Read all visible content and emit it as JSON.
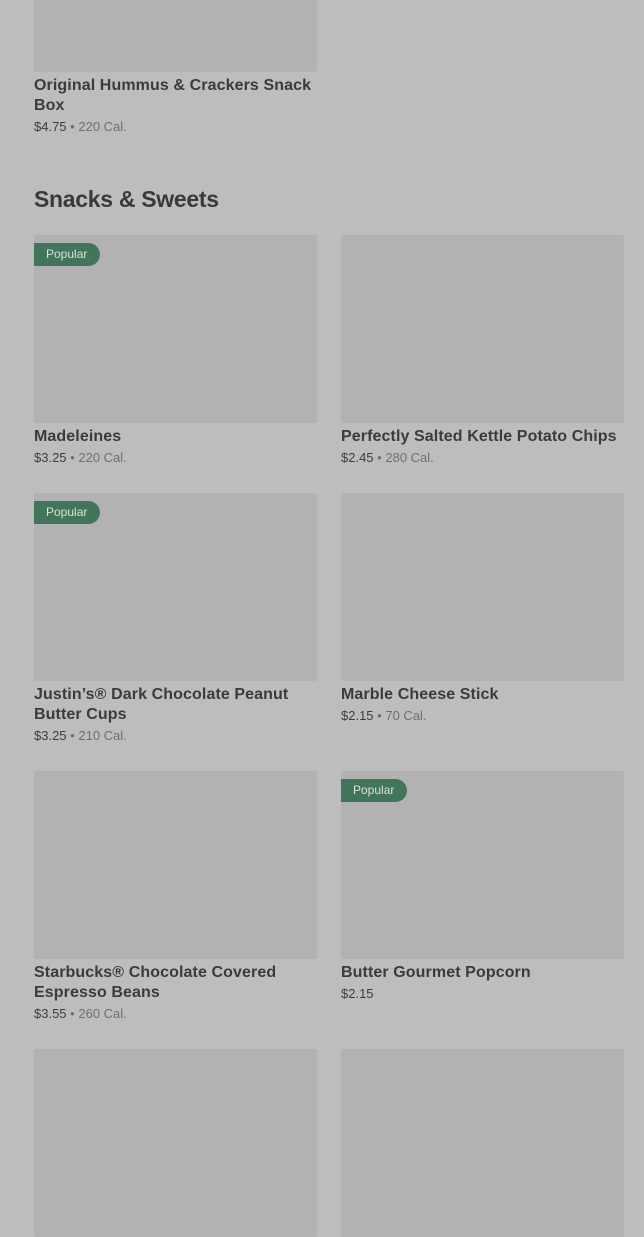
{
  "items": [
    {
      "name": "Original Hummus & Crackers Snack Box",
      "price": "$4.75",
      "sep": "•",
      "cal": "220 Cal."
    },
    {
      "name": "Madeleines",
      "price": "$3.25",
      "sep": "•",
      "cal": "220 Cal.",
      "badge": "Popular"
    },
    {
      "name": "Perfectly Salted Kettle Potato Chips",
      "price": "$2.45",
      "sep": "•",
      "cal": "280 Cal."
    },
    {
      "name": "Justin’s® Dark Chocolate Peanut Butter Cups",
      "price": "$3.25",
      "sep": "•",
      "cal": "210 Cal.",
      "badge": "Popular"
    },
    {
      "name": "Marble Cheese Stick",
      "price": "$2.15",
      "sep": "•",
      "cal": "70 Cal."
    },
    {
      "name": "Starbucks® Chocolate Covered Espresso Beans",
      "price": "$3.55",
      "sep": "•",
      "cal": "260 Cal."
    },
    {
      "name": "Butter Gourmet Popcorn",
      "price": "$2.15",
      "badge": "Popular"
    }
  ],
  "section": {
    "title": "Snacks & Sweets"
  }
}
